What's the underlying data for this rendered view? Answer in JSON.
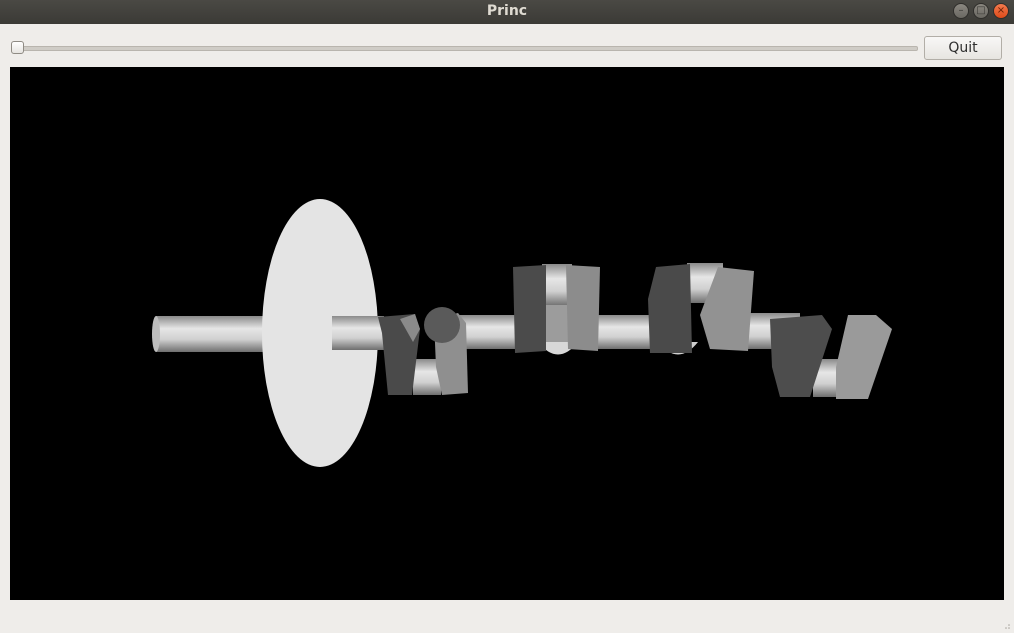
{
  "window": {
    "title": "Princ"
  },
  "window_controls": [
    "minimize-icon",
    "maximize-icon",
    "close-icon"
  ],
  "toolbar": {
    "slider": {
      "value": 0
    },
    "quit_label": "Quit"
  },
  "viewport": {
    "background": "#000000",
    "model_color": "#d9d9d9"
  }
}
